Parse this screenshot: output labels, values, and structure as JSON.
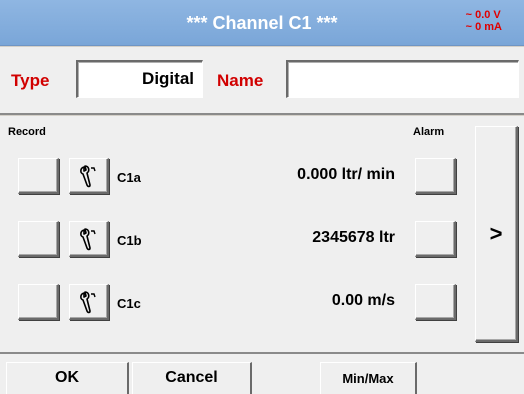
{
  "header": {
    "title": "***   Channel C1   ***",
    "status_voltage": "~ 0.0 V",
    "status_current": "~ 0 mA"
  },
  "config": {
    "type_label": "Type",
    "type_value": "Digital",
    "name_label": "Name",
    "name_value": ""
  },
  "table": {
    "record_label": "Record",
    "alarm_label": "Alarm",
    "rows": [
      {
        "channel": "C1a",
        "value": "0.000 ltr/ min"
      },
      {
        "channel": "C1b",
        "value": "2345678 ltr"
      },
      {
        "channel": "C1c",
        "value": "0.00 m/s"
      }
    ],
    "next_label": ">"
  },
  "footer": {
    "ok_label": "OK",
    "cancel_label": "Cancel",
    "minmax_label": "Min/Max"
  },
  "icons": {
    "settings": "wrench-icon"
  },
  "colors": {
    "title_bar": "#7aa6d8",
    "accent_red": "#d10000",
    "status_red": "#e00000",
    "panel_bg": "#efefef"
  }
}
